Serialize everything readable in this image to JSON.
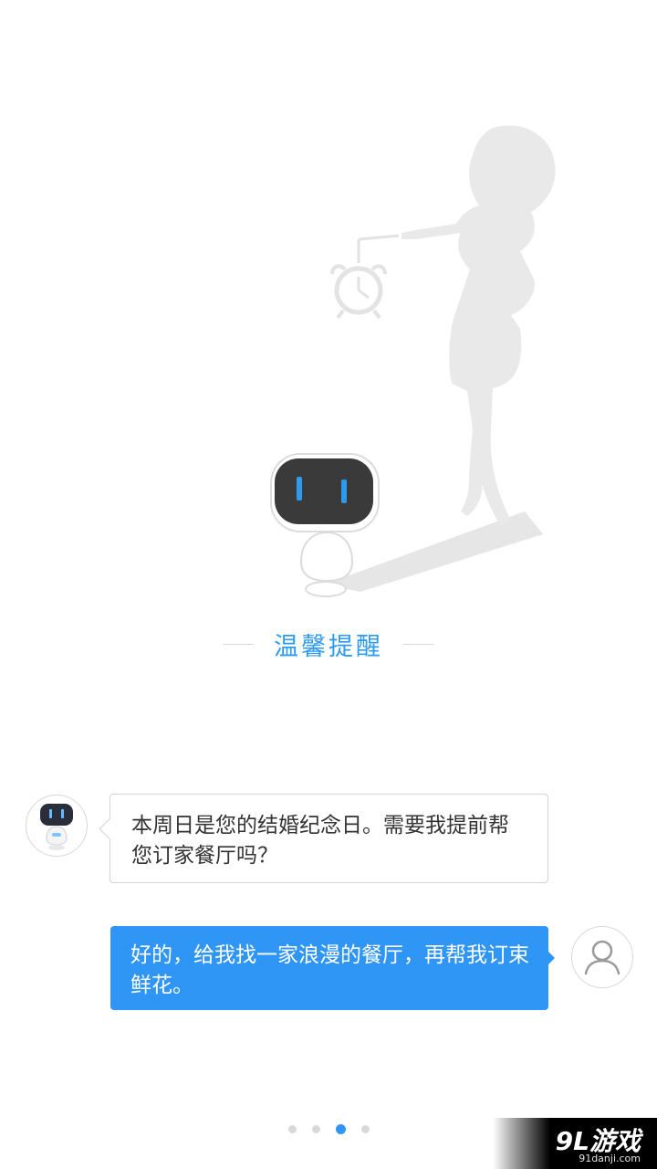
{
  "title": "温馨提醒",
  "chat": {
    "bot_message": "本周日是您的结婚纪念日。需要我提前帮您订家餐厅吗？",
    "user_message": "好的，给我找一家浪漫的餐厅，再帮我订束鲜花。"
  },
  "pager": {
    "total": 4,
    "active_index": 2
  },
  "watermark": {
    "logo": "9L游戏",
    "url": "91danji.com"
  },
  "icons": {
    "robot": "robot-mascot-icon",
    "user": "user-silhouette-icon",
    "clock": "alarm-clock-icon"
  },
  "colors": {
    "accent": "#3096f5",
    "title": "#2f9bf0",
    "silhouette": "#e9e9e9"
  }
}
